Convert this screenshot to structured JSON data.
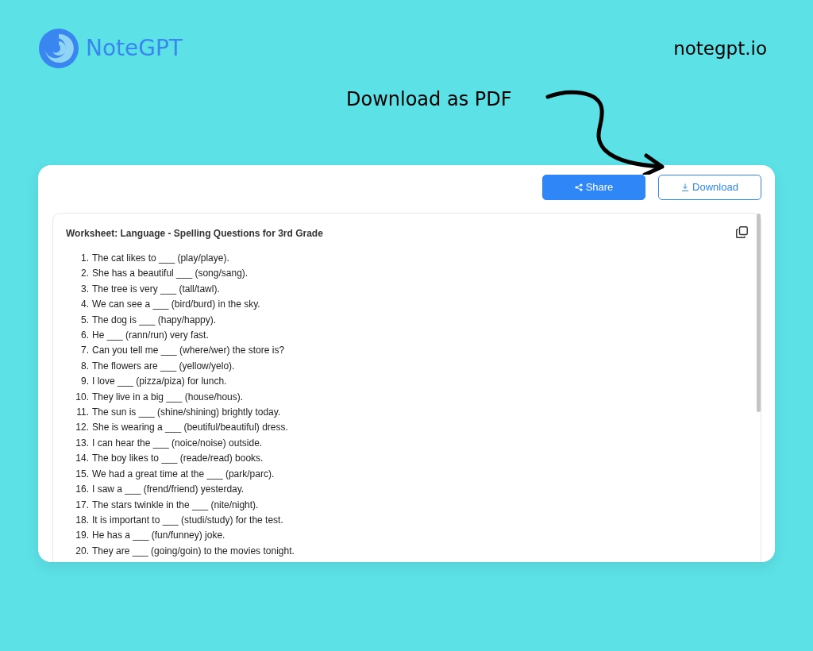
{
  "brand": {
    "name": "NoteGPT",
    "site": "notegpt.io"
  },
  "callout": {
    "text": "Download as PDF"
  },
  "toolbar": {
    "buttons": [
      {
        "label": "Share",
        "kind": "primary"
      },
      {
        "label": "Download",
        "kind": "outline"
      }
    ]
  },
  "document": {
    "title": "Worksheet: Language - Spelling Questions for 3rd Grade",
    "items": [
      {
        "number": "1.",
        "text": "The cat likes to ___ (play/playe)."
      },
      {
        "number": "2.",
        "text": "She has a beautiful ___ (song/sang)."
      },
      {
        "number": "3.",
        "text": "The tree is very ___ (tall/tawl)."
      },
      {
        "number": "4.",
        "text": "We can see a ___ (bird/burd) in the sky."
      },
      {
        "number": "5.",
        "text": "The dog is ___ (hapy/happy)."
      },
      {
        "number": "6.",
        "text": "He ___ (rann/run) very fast."
      },
      {
        "number": "7.",
        "text": "Can you tell me ___ (where/wer) the store is?"
      },
      {
        "number": "8.",
        "text": "The flowers are ___ (yellow/yelo)."
      },
      {
        "number": "9.",
        "text": "I love ___ (pizza/piza) for lunch."
      },
      {
        "number": "10.",
        "text": "They live in a big ___ (house/hous)."
      },
      {
        "number": "11.",
        "text": "The sun is ___ (shine/shining) brightly today."
      },
      {
        "number": "12.",
        "text": "She is wearing a ___ (beutiful/beautiful) dress."
      },
      {
        "number": "13.",
        "text": "I can hear the ___ (noice/noise) outside."
      },
      {
        "number": "14.",
        "text": "The boy likes to ___ (reade/read) books."
      },
      {
        "number": "15.",
        "text": "We had a great time at the ___ (park/parc)."
      },
      {
        "number": "16.",
        "text": "I saw a ___ (frend/friend) yesterday."
      },
      {
        "number": "17.",
        "text": "The stars twinkle in the ___ (nite/night)."
      },
      {
        "number": "18.",
        "text": "It is important to ___ (studi/study) for the test."
      },
      {
        "number": "19.",
        "text": "He has a ___ (fun/funney) joke."
      },
      {
        "number": "20.",
        "text": "They are ___ (going/goin) to the movies tonight."
      }
    ]
  }
}
